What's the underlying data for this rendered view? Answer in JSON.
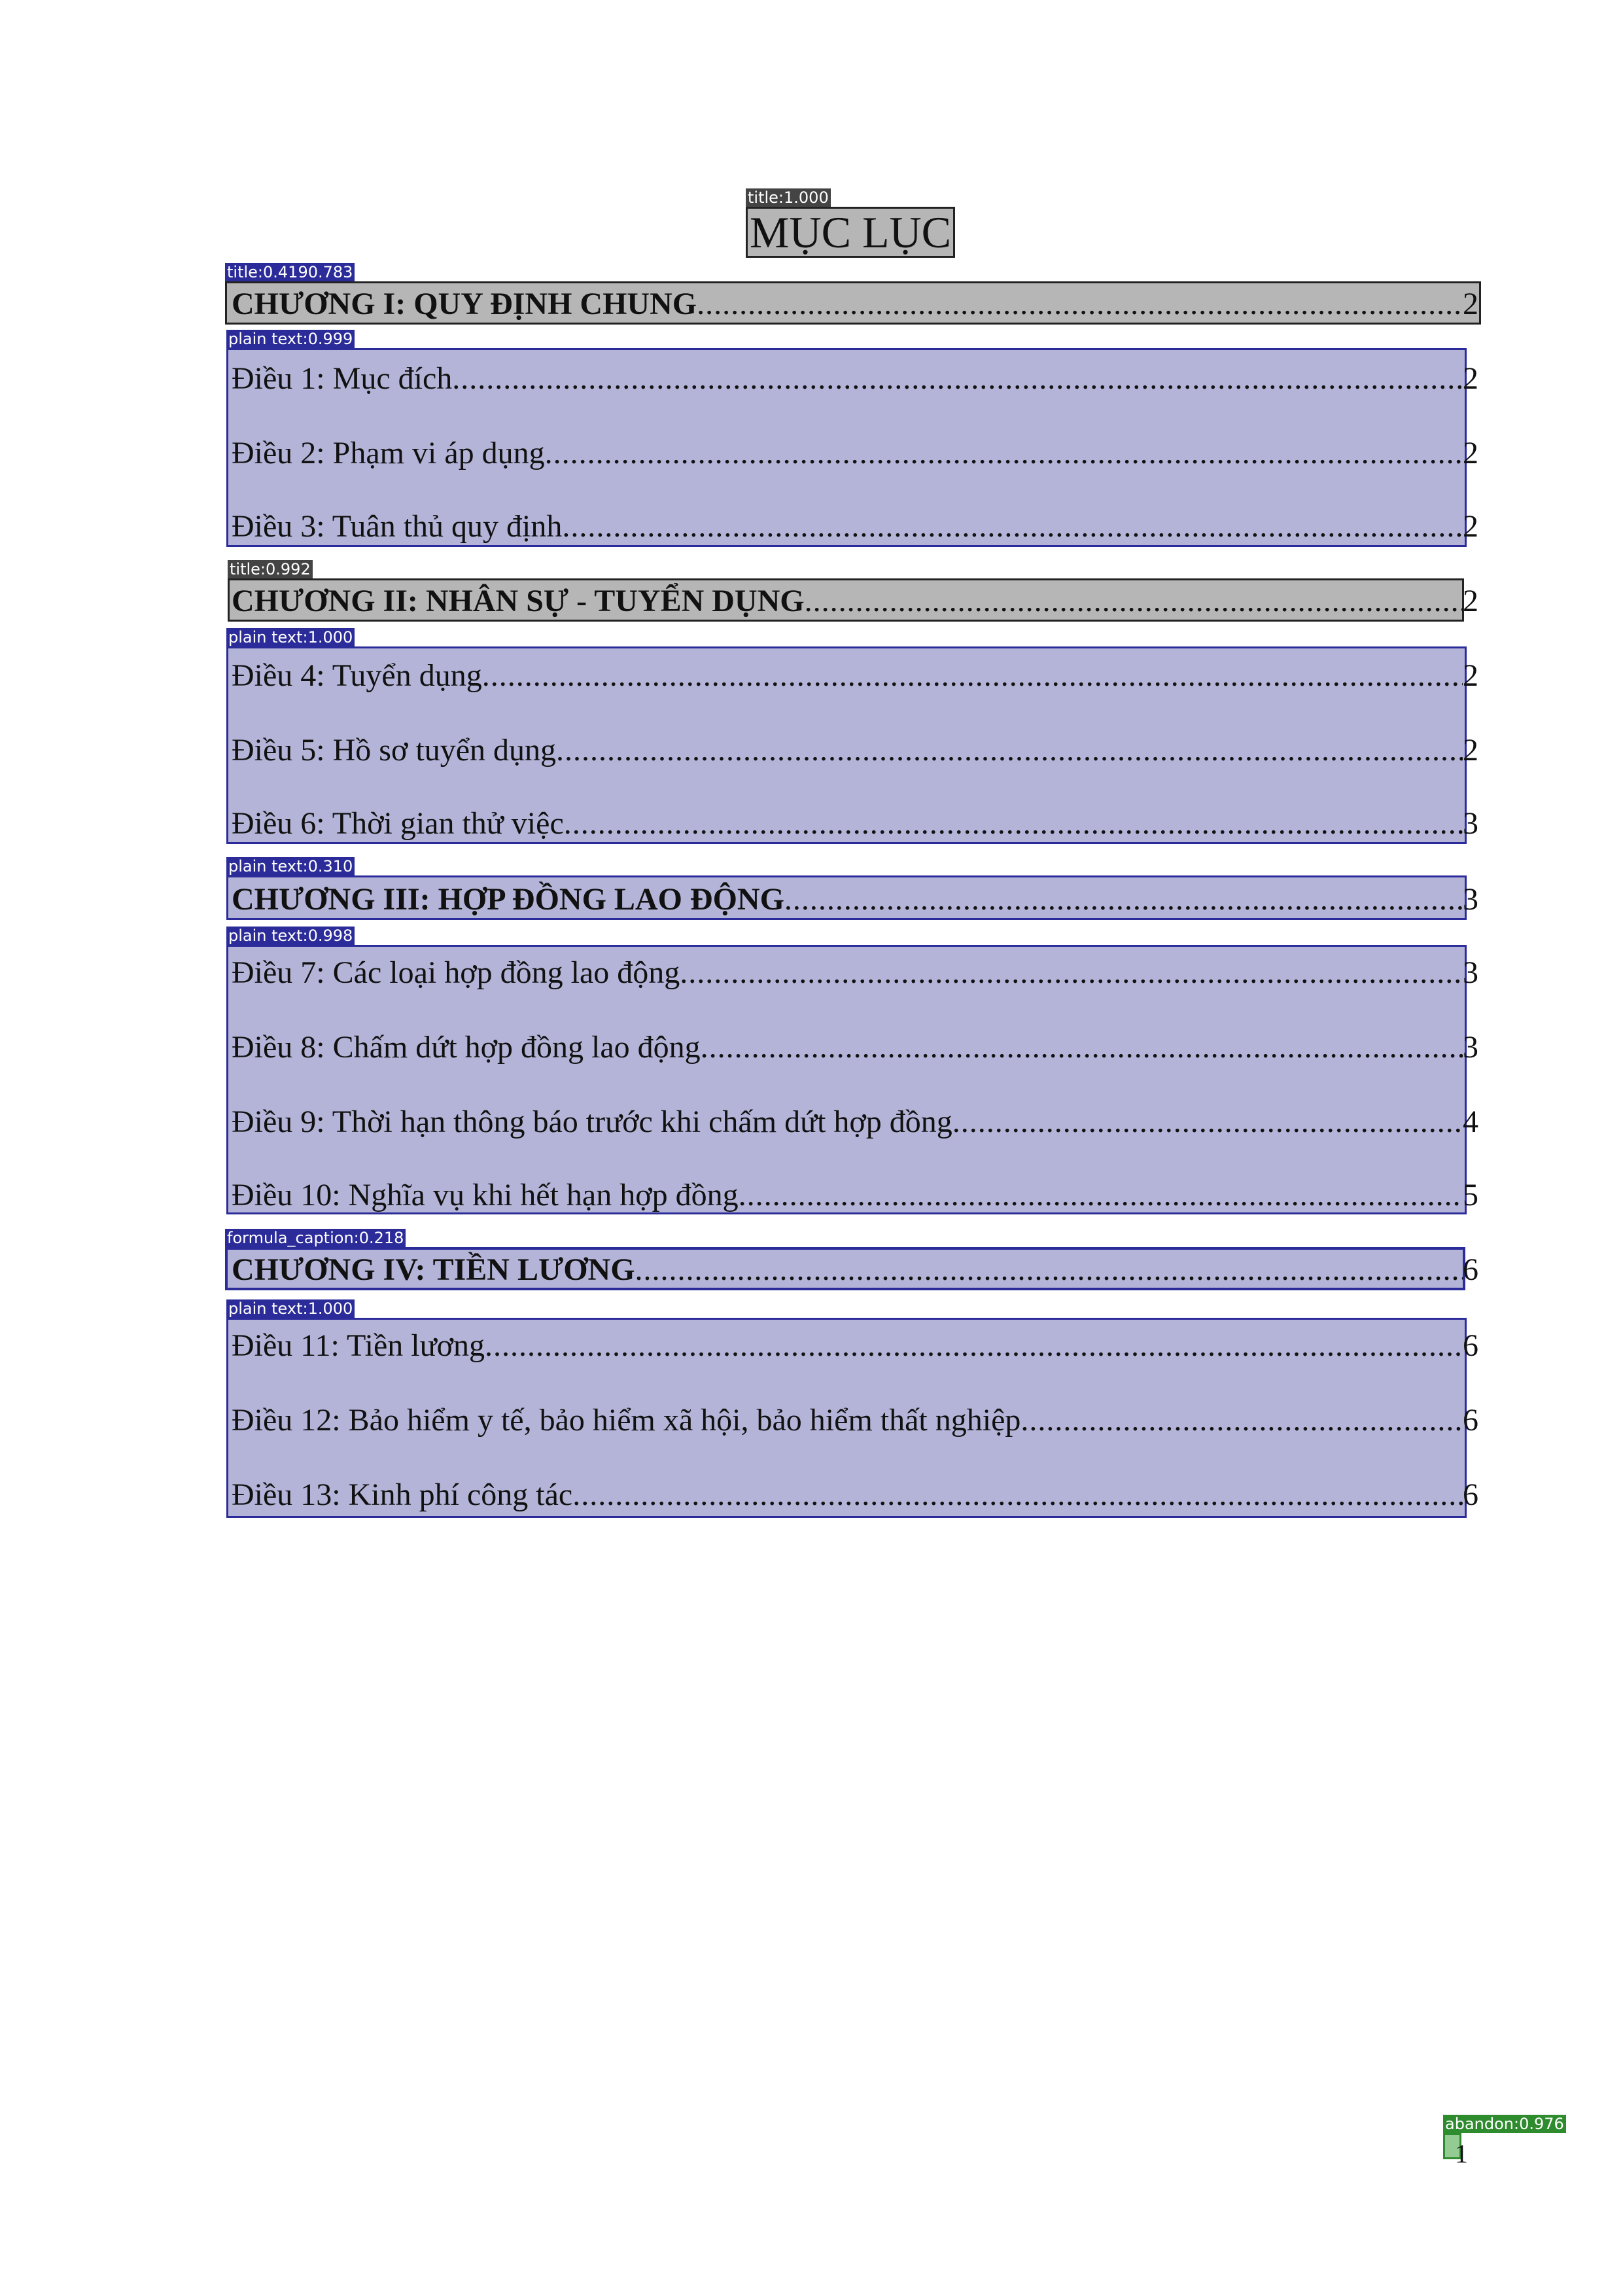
{
  "title": "MỤC LỤC",
  "labels": {
    "title_main": "title:1.000",
    "chapter_1": "title:0.4190.783",
    "block_1": "plain text:0.999",
    "chapter_2": "title:0.992",
    "block_2": "plain text:1.000",
    "chapter_3": "plain text:0.310",
    "block_3": "plain text:0.998",
    "chapter_4": "formula_caption:0.218",
    "block_4": "plain text:1.000",
    "page_number": "abandon:0.976"
  },
  "toc": [
    {
      "label": "CHƯƠNG I: QUY ĐỊNH CHUNG",
      "page": "2"
    },
    {
      "label": "Điều 1:  Mục đích",
      "page": "2"
    },
    {
      "label": "Điều 2:  Phạm vi áp dụng",
      "page": "2"
    },
    {
      "label": "Điều 3: Tuân thủ quy định",
      "page": "2"
    },
    {
      "label": "CHƯƠNG II: NHÂN SỰ - TUYỂN DỤNG",
      "page": "2"
    },
    {
      "label": "Điều 4: Tuyển dụng",
      "page": "2"
    },
    {
      "label": "Điều 5: Hồ sơ tuyển dụng",
      "page": "2"
    },
    {
      "label": "Điều 6: Thời gian thử việc",
      "page": "3"
    },
    {
      "label": "CHƯƠNG III: HỢP ĐỒNG LAO ĐỘNG",
      "page": "3"
    },
    {
      "label": "Điều 7: Các loại hợp đồng lao động",
      "page": "3"
    },
    {
      "label": "Điều 8: Chấm dứt hợp đồng lao động",
      "page": "3"
    },
    {
      "label": "Điều 9: Thời hạn thông báo trước khi chấm dứt hợp đồng",
      "page": "4"
    },
    {
      "label": "Điều 10: Nghĩa vụ khi hết hạn hợp đồng",
      "page": "5"
    },
    {
      "label": "CHƯƠNG IV: TIỀN LƯƠNG",
      "page": "6"
    },
    {
      "label": "Điều 11: Tiền lương",
      "page": "6"
    },
    {
      "label": "Điều 12: Bảo hiểm y tế, bảo hiểm xã hội, bảo hiểm thất nghiệp",
      "page": "6"
    },
    {
      "label": "Điều 13:  Kinh phí công tác",
      "page": "6"
    }
  ],
  "page_number": "1"
}
